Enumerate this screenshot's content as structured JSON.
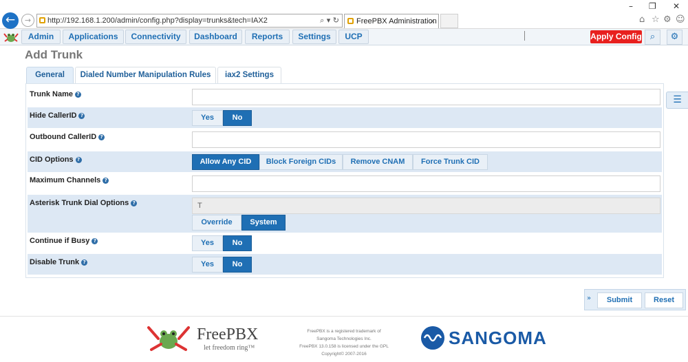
{
  "browser": {
    "url": "http://192.168.1.200/admin/config.php?display=trunks&tech=IAX2",
    "tab_title": "FreePBX Administration"
  },
  "nav": {
    "items": [
      "Admin",
      "Applications",
      "Connectivity",
      "Dashboard",
      "Reports",
      "Settings",
      "UCP"
    ],
    "apply_label": "Apply Config"
  },
  "page": {
    "title": "Add Trunk"
  },
  "tabs": [
    "General",
    "Dialed Number Manipulation Rules",
    "iax2 Settings"
  ],
  "form": {
    "trunk_name": {
      "label": "Trunk Name",
      "value": ""
    },
    "hide_callerid": {
      "label": "Hide CallerID",
      "options": [
        "Yes",
        "No"
      ],
      "selected": "No"
    },
    "outbound_callerid": {
      "label": "Outbound CallerID",
      "value": ""
    },
    "cid_options": {
      "label": "CID Options",
      "options": [
        "Allow Any CID",
        "Block Foreign CIDs",
        "Remove CNAM",
        "Force Trunk CID"
      ],
      "selected": "Allow Any CID"
    },
    "max_channels": {
      "label": "Maximum Channels",
      "value": ""
    },
    "dial_options": {
      "label": "Asterisk Trunk Dial Options",
      "value": "T",
      "options": [
        "Override",
        "System"
      ],
      "selected": "System"
    },
    "continue_busy": {
      "label": "Continue if Busy",
      "options": [
        "Yes",
        "No"
      ],
      "selected": "No"
    },
    "disable_trunk": {
      "label": "Disable Trunk",
      "options": [
        "Yes",
        "No"
      ],
      "selected": "No"
    }
  },
  "actions": {
    "submit": "Submit",
    "reset": "Reset"
  },
  "footer": {
    "freepbx_name": "FreePBX",
    "freepbx_tagline": "let freedom ring™",
    "legal": [
      "FreePBX is a registered trademark of",
      "Sangoma Technologies Inc.",
      "FreePBX 13.0.158 is licensed under the GPL",
      "Copyright© 2007-2016"
    ],
    "sangoma_name": "SANGOMA"
  },
  "colors": {
    "accent": "#1f6fb4",
    "apply": "#e8201e",
    "row_alt": "#dde8f4"
  }
}
